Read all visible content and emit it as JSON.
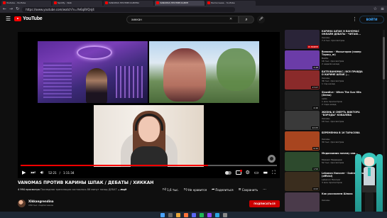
{
  "browser": {
    "tabs": [
      {
        "label": "Youtube - YouTube",
        "active": false
      },
      {
        "label": "Spotify - Web",
        "active": false
      },
      {
        "label": "VANOMAS ПРОТИВ КАРИНЫ",
        "active": false
      },
      {
        "label": "VANOMAS ПРОТИВ КАРИН",
        "active": true
      },
      {
        "label": "Расписание - YouTube",
        "active": false
      }
    ],
    "url": "https://www.youtube.com/watch?v=Ye6q8VQnJ4"
  },
  "header": {
    "logo_text": "YouTube",
    "search_value": "хиккан",
    "signin_label": "ВОЙТИ"
  },
  "player": {
    "time_current": "52:21",
    "time_total": "1:11:34",
    "progress_fraction": 0.73
  },
  "video": {
    "title": "VANOMAS ПРОТИВ КАРИНЫ ШПАК / ДЕБАТЫ / ХИККАН",
    "views": "4 994 просмотра",
    "desc": "Последняя трансляция состоялась 86 минут назад  ДЕБАТ",
    "more_label": "...ещё",
    "likes": "1,6 тыс.",
    "dislike_label": "Не нравится",
    "share_label": "Поделиться",
    "save_label": "Сохранить"
  },
  "channel": {
    "name": "Xikkangrendina",
    "subscribers": "150 тыс. подписчиков",
    "subscribe_label": "ПОДПИСАТЬСЯ"
  },
  "sidebar": {
    "items": [
      {
        "title": "КАРИНА ШПАК И ВАНОМАС ОНЛАЙН ДЕБАТЫ - ЧИТАЮ...",
        "channel": "Хиккан",
        "meta": "7,4 тыс. просмотров",
        "meta2": "",
        "duration": "В ЭФИРЕ",
        "live": true,
        "thumb": "#2a2438"
      },
      {
        "title": "Ваномас - Масштория (навер Тарасу_m)",
        "channel": "Вайбз",
        "meta": "16 тыс. просмотров",
        "meta2": "2 недели назад",
        "duration": "3:48",
        "live": false,
        "thumb": "#6b3ca8"
      },
      {
        "title": "БАТЯ ВАНОМАС | ВСЯ ПРАВДА О КАРИНЕ ШПАК |...",
        "channel": "Хиккан",
        "meta": "36 тыс. просмотров",
        "meta2": "1 год назад",
        "duration": "17:07",
        "live": false,
        "thumb": "#8a2a2a"
      },
      {
        "title": "Slowdive - When The Sun Hits (Demo)",
        "channel": "radio",
        "meta": "1 млн просмотров",
        "meta2": "2 года назад",
        "duration": "4:46",
        "live": false,
        "thumb": "#222222"
      },
      {
        "title": "ЖИЗНЬ И СМЕРТЬ ВИКТОРА \"БОРОДЫ\" КОВАЛЕВА",
        "channel": "Хиккан",
        "meta": "19 тыс. просмотров",
        "meta2": "",
        "duration": "22:05",
        "live": false,
        "thumb": "#3a3a3a"
      },
      {
        "title": "БЕРЕМЕННА В 16 ТАРАСОВА",
        "channel": "Хиккан",
        "meta": "30 тыс. просмотров",
        "meta2": "",
        "duration": "9:32",
        "live": false,
        "thumb": "#a8451f"
      },
      {
        "title": "Мединхимия почему они...",
        "channel": "Михаил Медведев",
        "meta": "52 тыс. просмотров",
        "meta2": "",
        "duration": "1:50",
        "live": false,
        "thumb": "#2d4a2d"
      },
      {
        "title": "Lebanon Hanover - Sadnessbow (official)",
        "channel": "Lebanon Hanover",
        "meta": "3 млн просмотров",
        "meta2": "",
        "duration": "4:02",
        "live": false,
        "thumb": "#3a2d1e"
      },
      {
        "title": "Как расскажем Шпака",
        "channel": "Хиккан",
        "meta": "",
        "meta2": "",
        "duration": "",
        "live": false,
        "thumb": "#4a3a4a"
      }
    ]
  },
  "colors": {
    "accent": "#ff0000",
    "background": "#0f0f0f",
    "link": "#3ea6ff",
    "hair": "#39c5bb"
  }
}
